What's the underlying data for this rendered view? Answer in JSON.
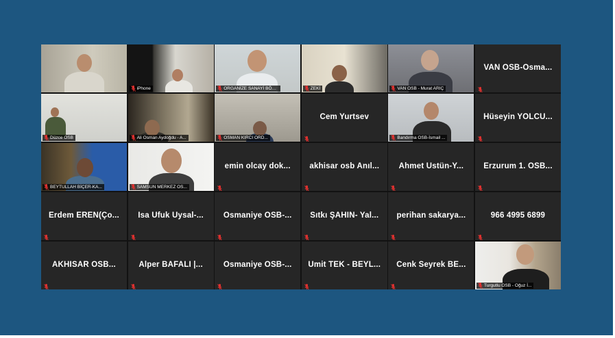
{
  "meeting": {
    "tiles": [
      {
        "label": "",
        "kind": "video",
        "active": true
      },
      {
        "label": "iPhone",
        "kind": "video"
      },
      {
        "label": "ORGANİZE SANAYİ BÖLG...",
        "kind": "video"
      },
      {
        "label": "ZEKİ",
        "kind": "video"
      },
      {
        "label": "VAN OSB - Murat ARIÇ",
        "kind": "video"
      },
      {
        "label": "VAN  OSB-Osma...",
        "kind": "name"
      },
      {
        "label": "Düzce OSB",
        "kind": "video"
      },
      {
        "label": "Ali Osman Aydoğdu - A...",
        "kind": "video"
      },
      {
        "label": "OSMAN KIRCI ORD...",
        "kind": "video"
      },
      {
        "label": "Cem Yurtsev",
        "kind": "name"
      },
      {
        "label": "Bandırma OSB-İsmail ...",
        "kind": "video"
      },
      {
        "label": "Hüseyin YOLCU...",
        "kind": "name"
      },
      {
        "label": "BEYTULLAH BİÇER-KA...",
        "kind": "video"
      },
      {
        "label": "SAMSUN MERKEZ OS...",
        "kind": "video"
      },
      {
        "label": "emin olcay dok...",
        "kind": "name"
      },
      {
        "label": "akhisar osb Anıl...",
        "kind": "name"
      },
      {
        "label": "Ahmet Üstün-Y...",
        "kind": "name"
      },
      {
        "label": "Erzurum 1. OSB...",
        "kind": "name"
      },
      {
        "label": "Erdem EREN(Ço...",
        "kind": "name"
      },
      {
        "label": "İsa Ufuk Uysal-...",
        "kind": "name"
      },
      {
        "label": "Osmaniye OSB-...",
        "kind": "name"
      },
      {
        "label": "Sıtkı ŞAHİN- Yal...",
        "kind": "name"
      },
      {
        "label": "perihan sakarya...",
        "kind": "name"
      },
      {
        "label": "966 4995 6899",
        "kind": "name"
      },
      {
        "label": "AKHİSAR  OSB...",
        "kind": "name"
      },
      {
        "label": "Alper BAFALI |...",
        "kind": "name"
      },
      {
        "label": "Osmaniye OSB-...",
        "kind": "name"
      },
      {
        "label": "Ümit TEK - BEYL...",
        "kind": "name"
      },
      {
        "label": "Cenk Seyrek BE...",
        "kind": "name"
      },
      {
        "label": "Turgutlu OSB - Oğuz İ...",
        "kind": "video"
      }
    ],
    "mute_icon": "microphone-muted-icon",
    "colors": {
      "background": "#1d5680",
      "grid": "#121212",
      "tile": "#262626",
      "active_speaker": "#8bd147",
      "mute": "#e0312f"
    }
  }
}
